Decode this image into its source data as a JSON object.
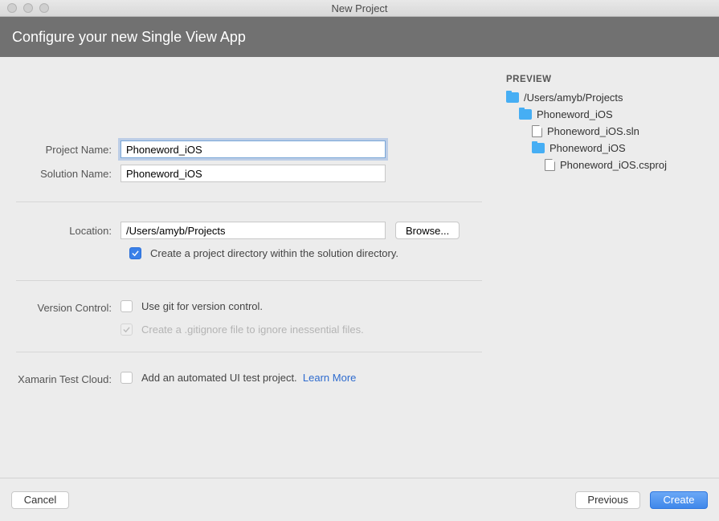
{
  "window_title": "New Project",
  "header": "Configure your new Single View App",
  "form": {
    "project_name_label": "Project Name:",
    "project_name_value": "Phoneword_iOS",
    "solution_name_label": "Solution Name:",
    "solution_name_value": "Phoneword_iOS",
    "location_label": "Location:",
    "location_value": "/Users/amyb/Projects",
    "browse_label": "Browse...",
    "create_dir_label": "Create a project directory within the solution directory.",
    "version_control_label": "Version Control:",
    "use_git_label": "Use git for version control.",
    "gitignore_label": "Create a .gitignore file to ignore inessential files.",
    "test_cloud_label": "Xamarin Test Cloud:",
    "add_test_label": "Add an automated UI test project.",
    "learn_more": "Learn More"
  },
  "preview": {
    "title": "PREVIEW",
    "root": "/Users/amyb/Projects",
    "folder1": "Phoneword_iOS",
    "file_sln": "Phoneword_iOS.sln",
    "folder2": "Phoneword_iOS",
    "file_csproj": "Phoneword_iOS.csproj"
  },
  "footer": {
    "cancel": "Cancel",
    "previous": "Previous",
    "create": "Create"
  }
}
